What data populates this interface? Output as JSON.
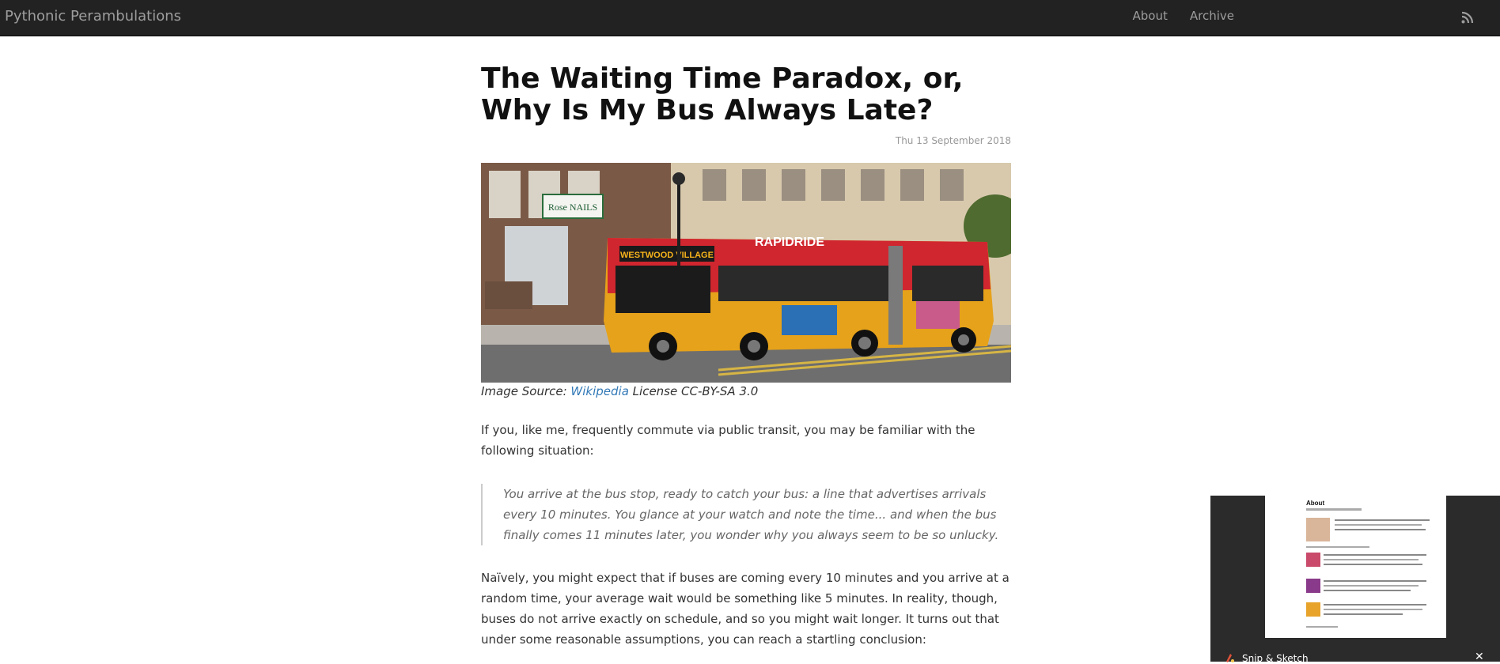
{
  "nav": {
    "brand": "Pythonic Perambulations",
    "links": [
      "About",
      "Archive"
    ],
    "rss_icon": "rss-icon"
  },
  "article": {
    "title": "The Waiting Time Paradox, or, Why Is My Bus Always Late?",
    "date": "Thu 13 September 2018",
    "caption_prefix": "Image Source: ",
    "caption_link": "Wikipedia",
    "caption_suffix": " License CC-BY-SA 3.0",
    "para1": "If you, like me, frequently commute via public transit, you may be familiar with the following situation:",
    "quote": "You arrive at the bus stop, ready to catch your bus: a line that advertises arrivals every 10 minutes. You glance at your watch and note the time... and when the bus finally comes 11 minutes later, you wonder why you always seem to be so unlucky.",
    "para2": "Naïvely, you might expect that if buses are coming every 10 minutes and you arrive at a random time, your average wait would be something like 5 minutes. In reality, though, buses do not arrive exactly on schedule, and so you might wait longer. It turns out that under some reasonable assumptions, you can reach a startling conclusion:"
  },
  "hero_image": {
    "bus_sign": "WESTWOOD VILLAGE",
    "bus_brand": "RAPIDRIDE",
    "store_sign": "Rose NAILS"
  },
  "snip": {
    "app_name": "Snip & Sketch",
    "thumb_heading": "About"
  },
  "colors": {
    "navbar": "#222222",
    "link": "#337ab7",
    "bus_red": "#d0262f",
    "bus_yellow": "#e6a21a"
  }
}
